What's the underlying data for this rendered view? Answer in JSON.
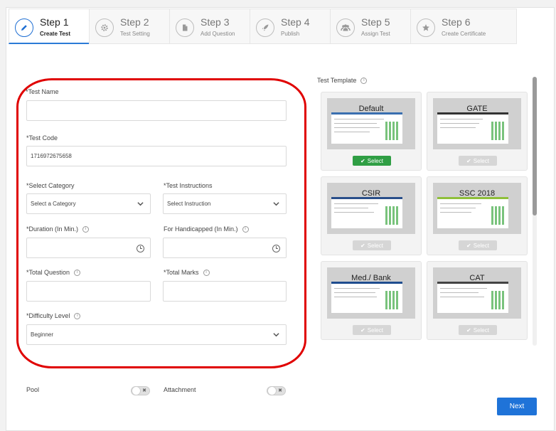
{
  "stepper": {
    "steps": [
      {
        "title": "Step 1",
        "subtitle": "Create Test",
        "icon": "pencil-icon"
      },
      {
        "title": "Step 2",
        "subtitle": "Test Setting",
        "icon": "gear-icon"
      },
      {
        "title": "Step 3",
        "subtitle": "Add Question",
        "icon": "document-icon"
      },
      {
        "title": "Step 4",
        "subtitle": "Publish",
        "icon": "rocket-icon"
      },
      {
        "title": "Step 5",
        "subtitle": "Assign Test",
        "icon": "users-icon"
      },
      {
        "title": "Step 6",
        "subtitle": "Create Certificate",
        "icon": "star-icon"
      }
    ]
  },
  "form": {
    "test_name_label": "*Test Name",
    "test_name_value": "",
    "test_code_label": "*Test Code",
    "test_code_value": "1716972675658",
    "category_label": "*Select Category",
    "category_value": "Select a Category",
    "instructions_label": "*Test Instructions",
    "instructions_value": "Select Instruction",
    "duration_label": "*Duration (In Min.)",
    "handicapped_label": "For Handicapped (In Min.)",
    "total_question_label": "*Total Question",
    "total_marks_label": "*Total Marks",
    "difficulty_label": "*Difficulty Level",
    "difficulty_value": "Beginner",
    "pool_label": "Pool",
    "attachment_label": "Attachment"
  },
  "templates": {
    "title": "Test Template",
    "select_label": "Select",
    "items": [
      {
        "name": "Default",
        "selected": true
      },
      {
        "name": "GATE",
        "selected": false
      },
      {
        "name": "CSIR",
        "selected": false
      },
      {
        "name": "SSC 2018",
        "selected": false
      },
      {
        "name": "Med./ Bank",
        "selected": false
      },
      {
        "name": "CAT",
        "selected": false
      }
    ]
  },
  "actions": {
    "next_label": "Next"
  },
  "colors": {
    "accent": "#1f73d8",
    "select_green": "#2f9e44",
    "highlight_red": "#e00000"
  }
}
